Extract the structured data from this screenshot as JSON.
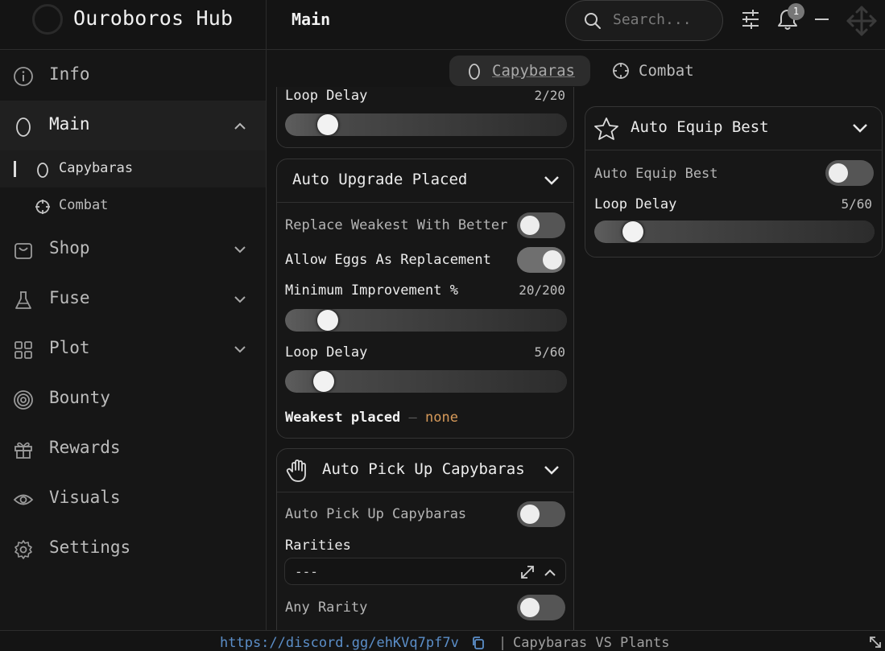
{
  "app": {
    "title": "Ouroboros Hub"
  },
  "header": {
    "page_title": "Main",
    "search_placeholder": "Search...",
    "notification_count": "1"
  },
  "sidebar": {
    "items": [
      {
        "label": "Info",
        "icon": "info-icon"
      },
      {
        "label": "Main",
        "icon": "egg-icon",
        "expanded": true
      },
      {
        "label": "Shop",
        "icon": "bag-icon"
      },
      {
        "label": "Fuse",
        "icon": "flask-icon"
      },
      {
        "label": "Plot",
        "icon": "grid-icon"
      },
      {
        "label": "Bounty",
        "icon": "target-icon"
      },
      {
        "label": "Rewards",
        "icon": "gift-icon"
      },
      {
        "label": "Visuals",
        "icon": "eye-icon"
      },
      {
        "label": "Settings",
        "icon": "gear-icon"
      }
    ],
    "sub_items": [
      {
        "label": "Capybaras",
        "icon": "egg-icon",
        "active": true
      },
      {
        "label": "Combat",
        "icon": "crosshair-icon"
      }
    ]
  },
  "tabs": [
    {
      "label": "Capybaras",
      "active": true
    },
    {
      "label": "Combat",
      "active": false
    }
  ],
  "partial_card": {
    "loop_delay_label": "Loop Delay",
    "loop_delay_value": "2/20",
    "loop_delay_fraction": 0.1
  },
  "auto_upgrade": {
    "title": "Auto Upgrade Placed",
    "replace_weakest_label": "Replace Weakest With Better",
    "replace_weakest_on": false,
    "allow_eggs_label": "Allow Eggs As Replacement",
    "allow_eggs_on": true,
    "min_improvement_label": "Minimum Improvement %",
    "min_improvement_value": "20/200",
    "min_improvement_fraction": 0.1,
    "loop_delay_label": "Loop Delay",
    "loop_delay_value": "5/60",
    "loop_delay_fraction": 0.083,
    "weakest_label": "Weakest placed",
    "weakest_sep": "–",
    "weakest_value": "none"
  },
  "auto_pickup": {
    "title": "Auto Pick Up Capybaras",
    "toggle_label": "Auto Pick Up Capybaras",
    "toggle_on": false,
    "rarities_label": "Rarities",
    "rarities_value": "---",
    "any_rarity_label": "Any Rarity",
    "any_rarity_on": false
  },
  "auto_equip": {
    "title": "Auto Equip Best",
    "toggle_label": "Auto Equip Best",
    "toggle_on": false,
    "loop_delay_label": "Loop Delay",
    "loop_delay_value": "5/60",
    "loop_delay_fraction": 0.083
  },
  "footer": {
    "discord_link": "https://discord.gg/ehKVq7pf7v",
    "separator": "|",
    "game_name": "Capybaras VS Plants"
  },
  "colors": {
    "background": "#151515",
    "panel": "#171717",
    "accent_orange": "#d79a5a",
    "link_blue": "#5b8ec8"
  }
}
